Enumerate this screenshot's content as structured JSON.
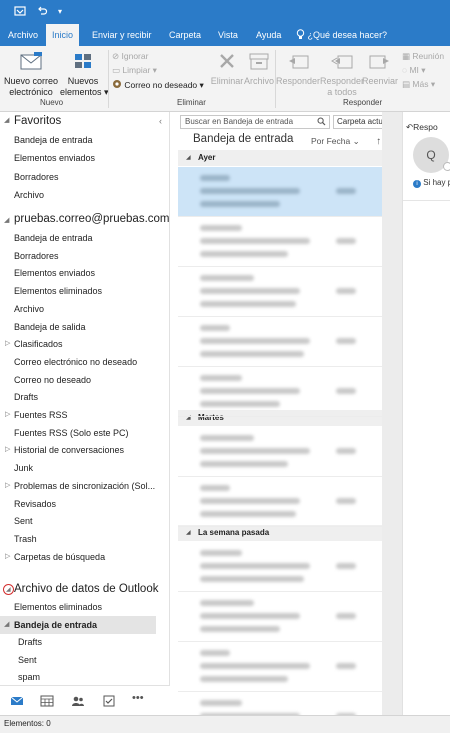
{
  "ribbon_tabs": [
    "Archivo",
    "Inicio",
    "Enviar y recibir",
    "Carpeta",
    "Vista",
    "Ayuda"
  ],
  "tell_me": "¿Qué desea hacer?",
  "ribbon": {
    "new_email": [
      "Nuevo correo",
      "electrónico"
    ],
    "new_items": [
      "Nuevos",
      "elementos"
    ],
    "group_new": "Nuevo",
    "ignore": "Ignorar",
    "clean": "Limpiar",
    "junk": "Correo no deseado",
    "delete": "Eliminar",
    "archive": "Archivo",
    "group_delete": "Eliminar",
    "reply": "Responder",
    "reply_all": [
      "Responder",
      "a todos"
    ],
    "forward": "Reenviar",
    "meeting": "Reunión",
    "im": "MI",
    "more": "Más",
    "group_respond": "Responder"
  },
  "folders": {
    "favorites_title": "Favoritos",
    "favorites": [
      "Bandeja de entrada",
      "Elementos enviados",
      "Borradores",
      "Archivo"
    ],
    "account_title": "pruebas.correo@pruebas.com",
    "account_folders": [
      "Bandeja de entrada",
      "Borradores",
      "Elementos enviados",
      "Elementos eliminados",
      "Archivo",
      "Bandeja de salida",
      "Clasificados",
      "Correo electrónico no deseado",
      "Correo no deseado",
      "Drafts",
      "Fuentes RSS",
      "Fuentes RSS (Solo este PC)",
      "Historial de conversaciones",
      "Junk",
      "Problemas de sincronización (Sol...",
      "Revisados",
      "Sent",
      "Trash",
      "Carpetas de búsqueda"
    ],
    "datafile_title": "Archivo de datos de Outlook",
    "datafile_folders": [
      "Elementos eliminados",
      "Bandeja de entrada",
      "Drafts",
      "Sent",
      "spam"
    ]
  },
  "status": "Elementos: 0",
  "list": {
    "search_placeholder": "Buscar en Bandeja de entrada",
    "scope": "Carpeta actual",
    "title": "Bandeja de entrada",
    "sort": "Por Fecha",
    "groups": [
      "Ayer",
      "Martes",
      "La semana pasada"
    ]
  },
  "reading": {
    "reply": "Respo",
    "avatar_letter": "Q",
    "info": "Si hay p"
  },
  "colors": {
    "brand": "#2b7bc8",
    "selected_message": "#cde4f7",
    "alert": "#d32f2f"
  }
}
